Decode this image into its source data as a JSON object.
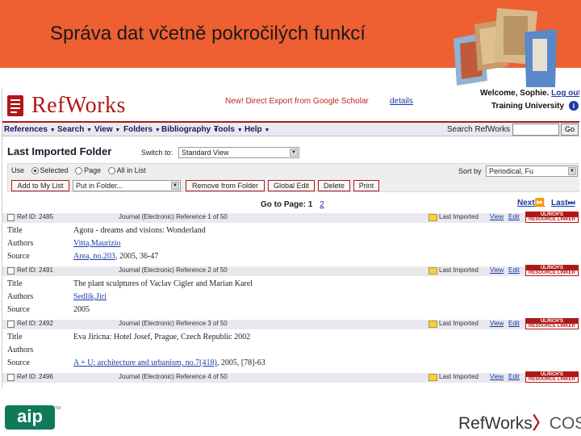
{
  "slide": {
    "title": "Správa dat včetně pokročilých funkcí"
  },
  "header": {
    "logo_text": "RefWorks",
    "news": "New! Direct Export from Google Scholar",
    "news_link": "details",
    "welcome": "Welcome, Sophie.",
    "logout": "Log out",
    "university": "Training University",
    "info_icon": "i"
  },
  "menu": {
    "items": [
      "References",
      "Search",
      "View",
      "Folders",
      "Bibliography",
      "Tools",
      "Help"
    ],
    "search_label": "Search RefWorks",
    "go_label": "Go"
  },
  "folder": {
    "title": "Last Imported Folder",
    "switch_label": "Switch to:",
    "view_value": "Standard View",
    "use_label": "Use",
    "radio_selected": "Selected",
    "radio_page": "Page",
    "radio_all": "All in List",
    "add_to_list": "Add to My List",
    "put_in_folder": "Put in Folder...",
    "remove": "Remove from Folder",
    "global_edit": "Global Edit",
    "delete": "Delete",
    "print": "Print",
    "sort_label": "Sort by",
    "sort_value": "Periodical, Fu"
  },
  "pager": {
    "label": "Go to Page:",
    "page1": "1",
    "page2": "2",
    "next": "Next",
    "last": "Last"
  },
  "references": [
    {
      "id": "Ref ID: 2485",
      "type": "Journal (Electronic) Reference 1 of 50",
      "folder": "Last Imported",
      "view": "View",
      "edit": "Edit",
      "title": "Agora - dreams and visions: Wonderland",
      "authors": "Vitta,Maurizio",
      "source_link": "Area, no.203",
      "source_rest": ", 2005, 36-47"
    },
    {
      "id": "Ref ID: 2491",
      "type": "Journal (Electronic) Reference 2 of 50",
      "folder": "Last Imported",
      "view": "View",
      "edit": "Edit",
      "title": "The plant sculptures of Vaclav Cigler and Marian Karel",
      "authors": "Sedlik,Jiri",
      "source_link": "",
      "source_rest": "2005"
    },
    {
      "id": "Ref ID: 2492",
      "type": "Journal (Electronic) Reference 3 of 50",
      "folder": "Last Imported",
      "view": "View",
      "edit": "Edit",
      "title": "Eva Jiricna: Hotel Josef, Prague, Czech Republic 2002",
      "authors": "",
      "source_link": "A + U: architecture and urbanism, no.7(418)",
      "source_rest": ", 2005, [78]-63"
    },
    {
      "id": "Ref ID: 2496",
      "type": "Journal (Electronic) Reference 4 of 50",
      "folder": "Last Imported",
      "view": "View",
      "edit": "Edit"
    }
  ],
  "field_labels": {
    "title": "Title",
    "authors": "Authors",
    "source": "Source"
  },
  "ulrich": {
    "line1": "ULRICH'S",
    "line2": "RESOURCE LINKER"
  },
  "footer": {
    "aip": "aip",
    "tm": "TM",
    "refworks": "RefWorks",
    "cos": "COS"
  },
  "colors": {
    "header_orange": "#ee5f32",
    "brand_red": "#b01818",
    "link_blue": "#1a3aa5"
  }
}
